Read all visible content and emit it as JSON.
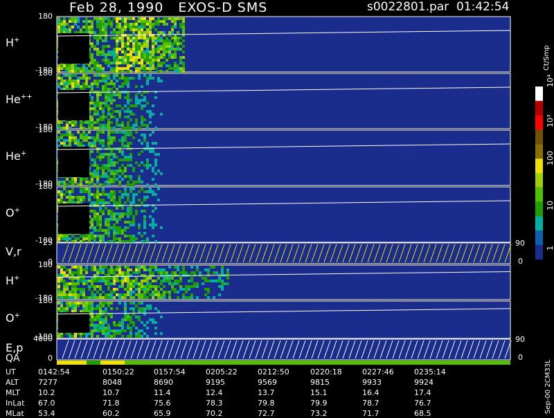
{
  "header": {
    "title": "Feb 28, 1990   EXOS-D SMS",
    "file": "s0022801.par  01:42:54"
  },
  "panels": [
    {
      "label": "H",
      "sup": "+",
      "top": "180",
      "bottom": "-180"
    },
    {
      "label": "He",
      "sup": "++",
      "top": "180",
      "bottom": "-180"
    },
    {
      "label": "He",
      "sup": "+",
      "top": "180",
      "bottom": "-180"
    },
    {
      "label": "O",
      "sup": "+",
      "top": "180",
      "bottom": "-180"
    },
    {
      "label": "V,r",
      "sup": "",
      "top": "25",
      "bottom": "0",
      "rtop": "90",
      "rbottom": "0"
    },
    {
      "label": "H",
      "sup": "+",
      "top": "180",
      "bottom": "-180"
    },
    {
      "label": "O",
      "sup": "+",
      "top": "180",
      "bottom": "-180"
    },
    {
      "label": "E,p",
      "sup": "",
      "top": "4000",
      "bottom": "0",
      "rtop": "90",
      "rbottom": "0"
    }
  ],
  "qa_label": "QA",
  "colorbar": {
    "label": "Ct/Smp",
    "ticks": [
      "10⁴",
      "10³",
      "100",
      "10",
      "1"
    ],
    "colors": [
      "#ffffff",
      "#b50000",
      "#ff0000",
      "#6e5200",
      "#8a7000",
      "#f0e000",
      "#a0d000",
      "#50c000",
      "#20a000",
      "#00b0a0",
      "#1060b0",
      "#1a2d8c"
    ]
  },
  "ephemeris": {
    "rows": [
      {
        "name": "UT",
        "values": [
          "0142:54",
          "0150:22",
          "0157:54",
          "0205:22",
          "0212:50",
          "0220:18",
          "0227:46",
          "0235:14"
        ]
      },
      {
        "name": "ALT",
        "values": [
          "7277",
          "8048",
          "8690",
          "9195",
          "9569",
          "9815",
          "9933",
          "9924"
        ]
      },
      {
        "name": "MLT",
        "values": [
          "10.2",
          "10.7",
          "11.4",
          "12.4",
          "13.7",
          "15.1",
          "16.4",
          "17.4"
        ]
      },
      {
        "name": "InLat",
        "values": [
          "67.0",
          "71.8",
          "75.6",
          "78.3",
          "79.8",
          "79.9",
          "78.7",
          "76.7"
        ]
      },
      {
        "name": "MLat",
        "values": [
          "53.4",
          "60.2",
          "65.9",
          "70.2",
          "72.7",
          "73.2",
          "71.7",
          "68.5"
        ]
      }
    ]
  },
  "version": "Sep-00 2CM33L",
  "chart_data": {
    "type": "heatmap",
    "title": "Feb 28, 1990   EXOS-D SMS",
    "xlabel": "UT",
    "x_ticks": [
      "0142:54",
      "0150:22",
      "0157:54",
      "0205:22",
      "0212:50",
      "0220:18",
      "0227:46",
      "0235:14"
    ],
    "ylim": [
      -180,
      180
    ],
    "color_scale": "log",
    "color_range": [
      1,
      10000
    ],
    "colorbar_label": "Ct/Smp",
    "series": [
      {
        "name": "H+",
        "ylim": [
          -180,
          180
        ]
      },
      {
        "name": "He++",
        "ylim": [
          -180,
          180
        ]
      },
      {
        "name": "He+",
        "ylim": [
          -180,
          180
        ]
      },
      {
        "name": "O+",
        "ylim": [
          -180,
          180
        ]
      },
      {
        "name": "V,r",
        "ylim": [
          0,
          25
        ]
      },
      {
        "name": "H+",
        "ylim": [
          -180,
          180
        ]
      },
      {
        "name": "O+",
        "ylim": [
          -180,
          180
        ]
      },
      {
        "name": "E,p",
        "ylim": [
          0,
          4000
        ]
      }
    ]
  }
}
